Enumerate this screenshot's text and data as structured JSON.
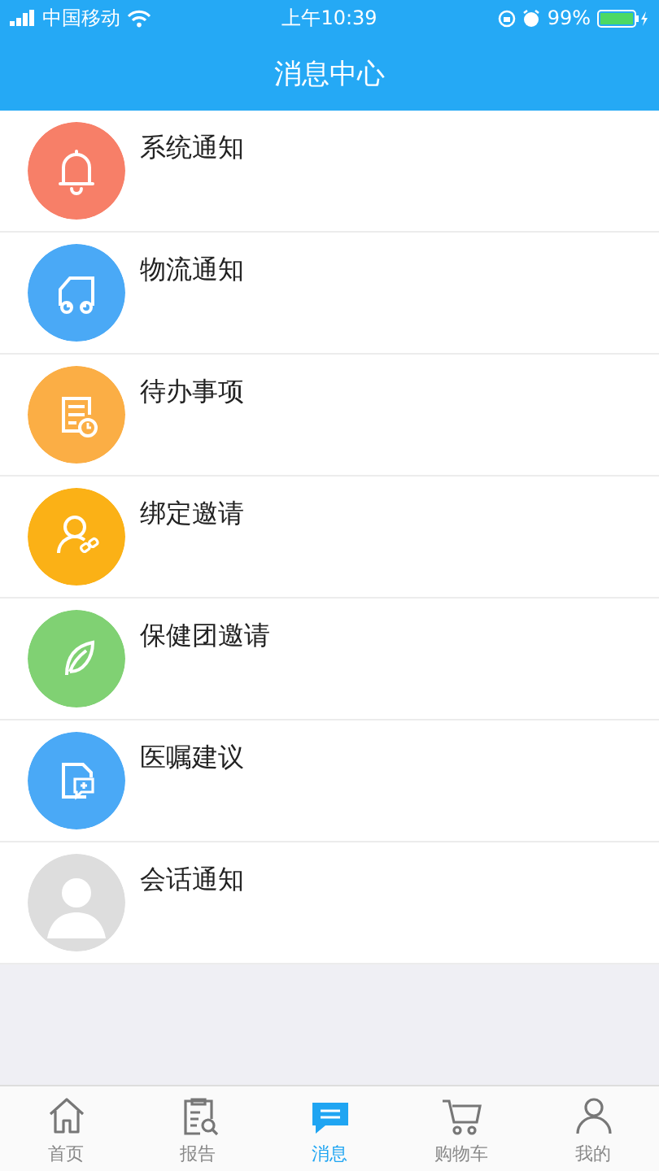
{
  "status_bar": {
    "carrier": "中国移动",
    "time": "上午10:39",
    "battery": "99%"
  },
  "header": {
    "title": "消息中心"
  },
  "messages": [
    {
      "title": "系统通知",
      "kind": "bell",
      "color": "#f77f68"
    },
    {
      "title": "物流通知",
      "kind": "truck",
      "color": "#4aa9f6"
    },
    {
      "title": "待办事项",
      "kind": "todo",
      "color": "#fbae45"
    },
    {
      "title": "绑定邀请",
      "kind": "user",
      "color": "#fbb116"
    },
    {
      "title": "保健团邀请",
      "kind": "leaf",
      "color": "#80d173"
    },
    {
      "title": "医嘱建议",
      "kind": "document",
      "color": "#4aa9f6"
    },
    {
      "title": "会话通知",
      "kind": "avatar",
      "color": "#dddddd"
    }
  ],
  "tab_bar": [
    {
      "label": "首页",
      "kind": "home",
      "selected": false
    },
    {
      "label": "报告",
      "kind": "report",
      "selected": false
    },
    {
      "label": "消息",
      "kind": "chat",
      "selected": true
    },
    {
      "label": "购物车",
      "kind": "cart",
      "selected": false
    },
    {
      "label": "我的",
      "kind": "person",
      "selected": false
    }
  ]
}
